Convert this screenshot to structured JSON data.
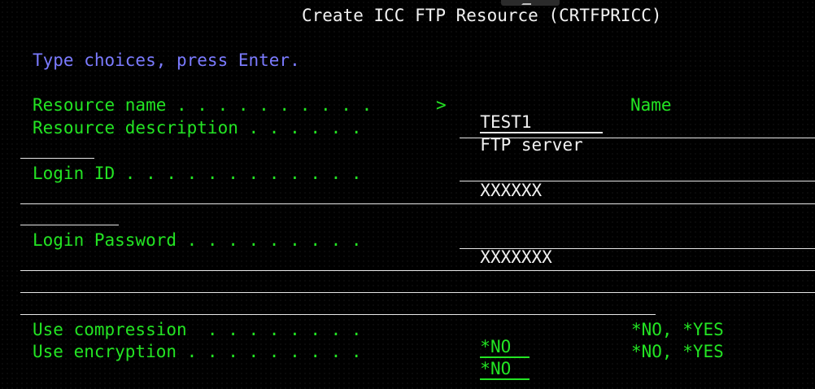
{
  "screen": {
    "title": "Create ICC FTP Resource (CRTFPRICC)",
    "instruction": "Type choices, press Enter."
  },
  "fields": {
    "resource_name": {
      "label": "Resource name . . . . . . . . . .",
      "marker": ">",
      "value": "TEST1",
      "hint": "Name"
    },
    "resource_description": {
      "label": "Resource description . . . . . .",
      "value": "FTP server"
    },
    "login_id": {
      "label": "Login ID . . . . . . . . . . . .",
      "value": "XXXXXX"
    },
    "login_password": {
      "label": "Login Password . . . . . . . . .",
      "value": "XXXXXXX"
    },
    "use_compression": {
      "label": "Use compression  . . . . . . . .",
      "value": "*NO",
      "hint": "*NO, *YES"
    },
    "use_encryption": {
      "label": "Use encryption . . . . . . . . .",
      "value": "*NO",
      "hint": "*NO, *YES"
    }
  },
  "colors": {
    "background": "#000000",
    "title": "#f2f2f2",
    "instruction": "#7b7bff",
    "label": "#23e423",
    "input": "#f2f2f2"
  }
}
